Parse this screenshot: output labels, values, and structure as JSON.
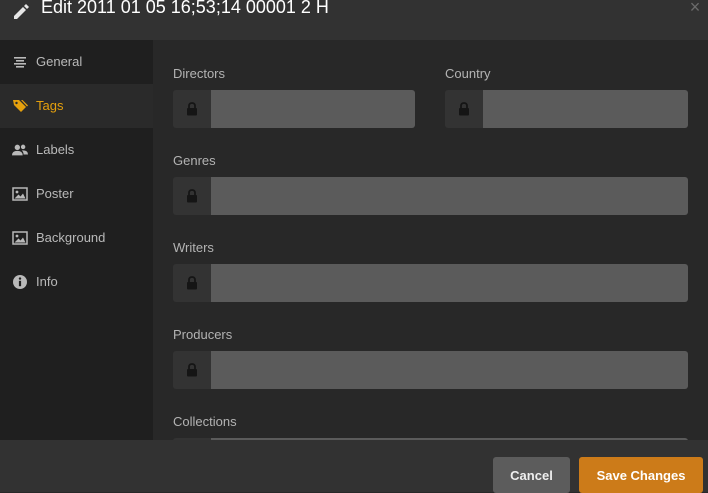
{
  "header": {
    "title": "Edit 2011 01 05 16;53;14 00001 2 H",
    "close_glyph": "×",
    "title_icon": "pencil-icon"
  },
  "sidebar": {
    "items": [
      {
        "label": "General",
        "icon": "align-center-icon",
        "active": false
      },
      {
        "label": "Tags",
        "icon": "tag-icon",
        "active": true
      },
      {
        "label": "Labels",
        "icon": "users-icon",
        "active": false
      },
      {
        "label": "Poster",
        "icon": "image-icon",
        "active": false
      },
      {
        "label": "Background",
        "icon": "image-icon",
        "active": false
      },
      {
        "label": "Info",
        "icon": "info-icon",
        "active": false
      }
    ]
  },
  "fields": {
    "directors": {
      "label": "Directors",
      "value": ""
    },
    "country": {
      "label": "Country",
      "value": ""
    },
    "genres": {
      "label": "Genres",
      "value": ""
    },
    "writers": {
      "label": "Writers",
      "value": ""
    },
    "producers": {
      "label": "Producers",
      "value": ""
    },
    "collections": {
      "label": "Collections",
      "value": ""
    }
  },
  "footer": {
    "cancel_label": "Cancel",
    "save_label": "Save Changes"
  },
  "colors": {
    "accent": "#e5a00d",
    "save_button": "#cc7b19",
    "header_bg": "#323232",
    "sidebar_bg": "#1f1f1f",
    "content_bg": "#282828",
    "input_bg": "#5b5b5b"
  }
}
